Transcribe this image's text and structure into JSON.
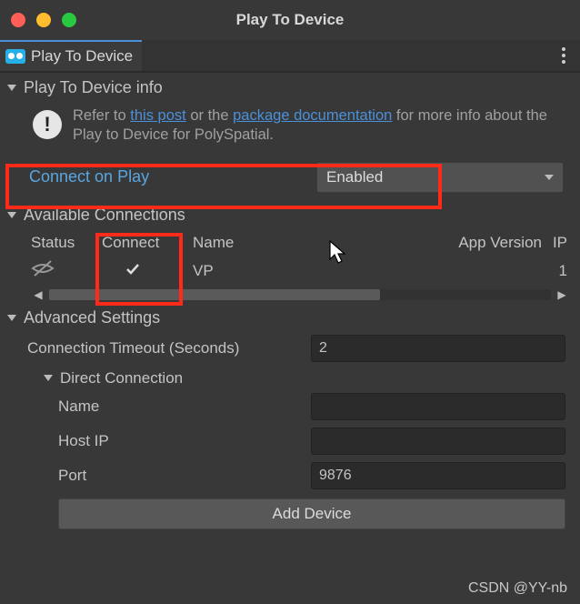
{
  "window": {
    "title": "Play To Device"
  },
  "tab": {
    "label": "Play To Device"
  },
  "section_info": {
    "title": "Play To Device info"
  },
  "info": {
    "prefix": "Refer to ",
    "link1": "this post",
    "mid": " or the ",
    "link2": "package documentation",
    "suffix": " for more info about the Play to Device for PolySpatial."
  },
  "connect_on_play": {
    "label": "Connect on Play",
    "value": "Enabled"
  },
  "available": {
    "title": "Available Connections",
    "headers": {
      "status": "Status",
      "connect": "Connect",
      "name": "Name",
      "app_version": "App Version",
      "ip": "IP"
    },
    "row": {
      "connect_checked": true,
      "name": "VP",
      "tail": "1"
    }
  },
  "advanced": {
    "title": "Advanced Settings",
    "timeout_label": "Connection Timeout (Seconds)",
    "timeout_value": "2",
    "direct": {
      "title": "Direct Connection",
      "name_label": "Name",
      "name_value": "",
      "host_label": "Host IP",
      "host_value": "",
      "port_label": "Port",
      "port_value": "9876"
    },
    "add_button": "Add Device"
  },
  "watermark": "CSDN @YY-nb"
}
